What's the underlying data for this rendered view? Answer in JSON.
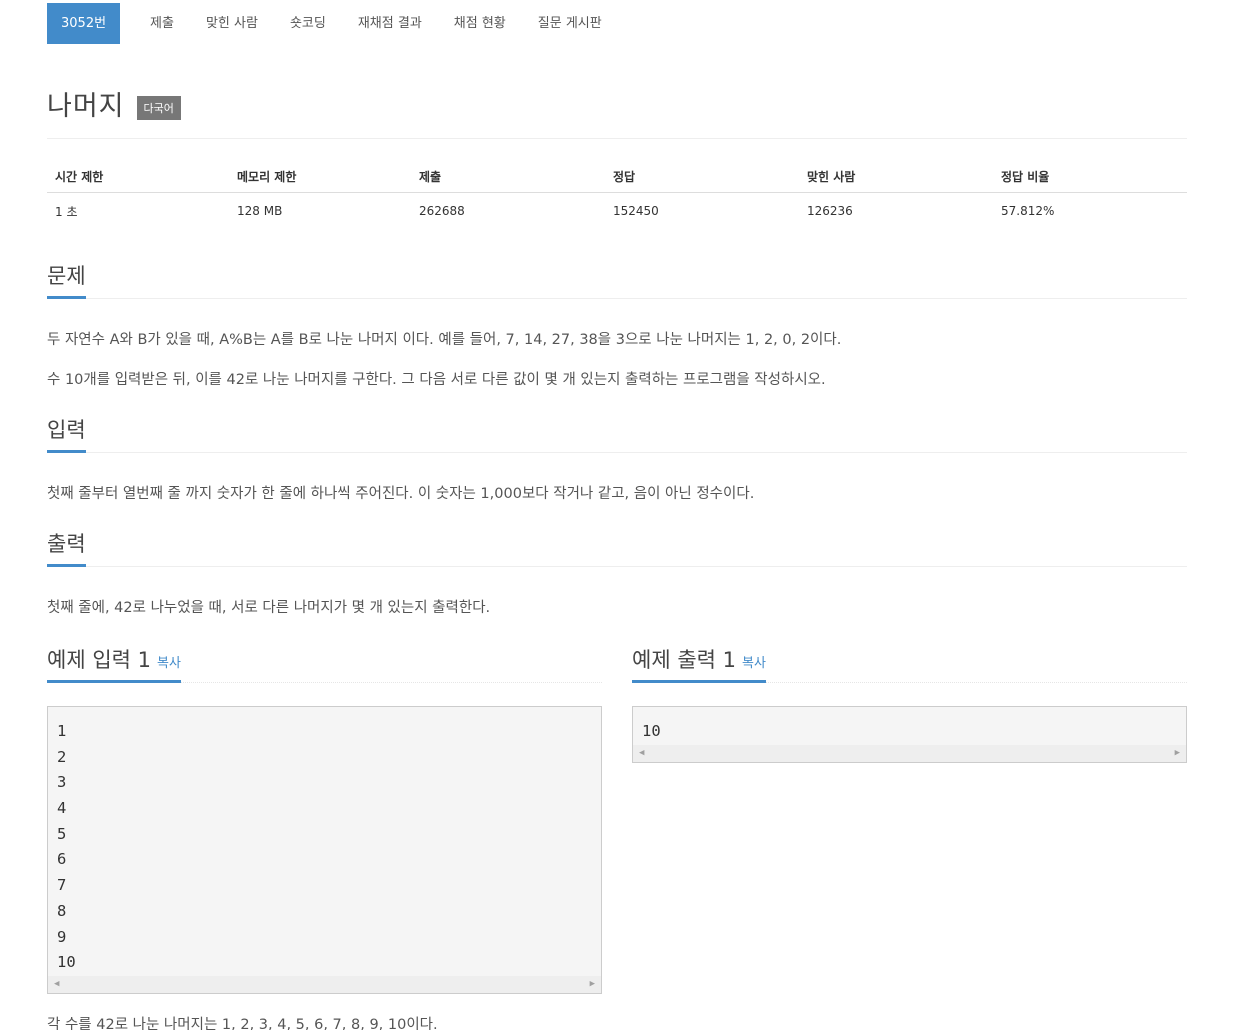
{
  "nav": {
    "tabs": [
      {
        "label": "3052번",
        "active": true
      },
      {
        "label": "제출"
      },
      {
        "label": "맞힌 사람"
      },
      {
        "label": "숏코딩"
      },
      {
        "label": "재채점 결과"
      },
      {
        "label": "채점 현황"
      },
      {
        "label": "질문 게시판"
      }
    ]
  },
  "problem": {
    "title": "나머지",
    "language_badge": "다국어"
  },
  "stats": {
    "headers": [
      "시간 제한",
      "메모리 제한",
      "제출",
      "정답",
      "맞힌 사람",
      "정답 비율"
    ],
    "values": [
      "1 초",
      "128 MB",
      "262688",
      "152450",
      "126236",
      "57.812%"
    ]
  },
  "description": {
    "heading": "문제",
    "paragraphs": [
      "두 자연수 A와 B가 있을 때, A%B는 A를 B로 나눈 나머지 이다. 예를 들어, 7, 14, 27, 38을 3으로 나눈 나머지는 1, 2, 0, 2이다.",
      "수 10개를 입력받은 뒤, 이를 42로 나눈 나머지를 구한다. 그 다음 서로 다른 값이 몇 개 있는지 출력하는 프로그램을 작성하시오."
    ]
  },
  "input": {
    "heading": "입력",
    "text": "첫째 줄부터 열번째 줄 까지 숫자가 한 줄에 하나씩 주어진다. 이 숫자는 1,000보다 작거나 같고, 음이 아닌 정수이다."
  },
  "output": {
    "heading": "출력",
    "text": "첫째 줄에, 42로 나누었을 때, 서로 다른 나머지가 몇 개 있는지 출력한다."
  },
  "sample_input": {
    "heading": "예제 입력 1",
    "copy_label": "복사",
    "lines": [
      "1",
      "2",
      "3",
      "4",
      "5",
      "6",
      "7",
      "8",
      "9",
      "10"
    ]
  },
  "sample_output": {
    "heading": "예제 출력 1",
    "copy_label": "복사",
    "lines": [
      "10"
    ]
  },
  "hint": {
    "text": "각 수를 42로 나눈 나머지는 1, 2, 3, 4, 5, 6, 7, 8, 9, 10이다."
  },
  "colors": {
    "accent": "#428bca",
    "badge": "#777777"
  }
}
